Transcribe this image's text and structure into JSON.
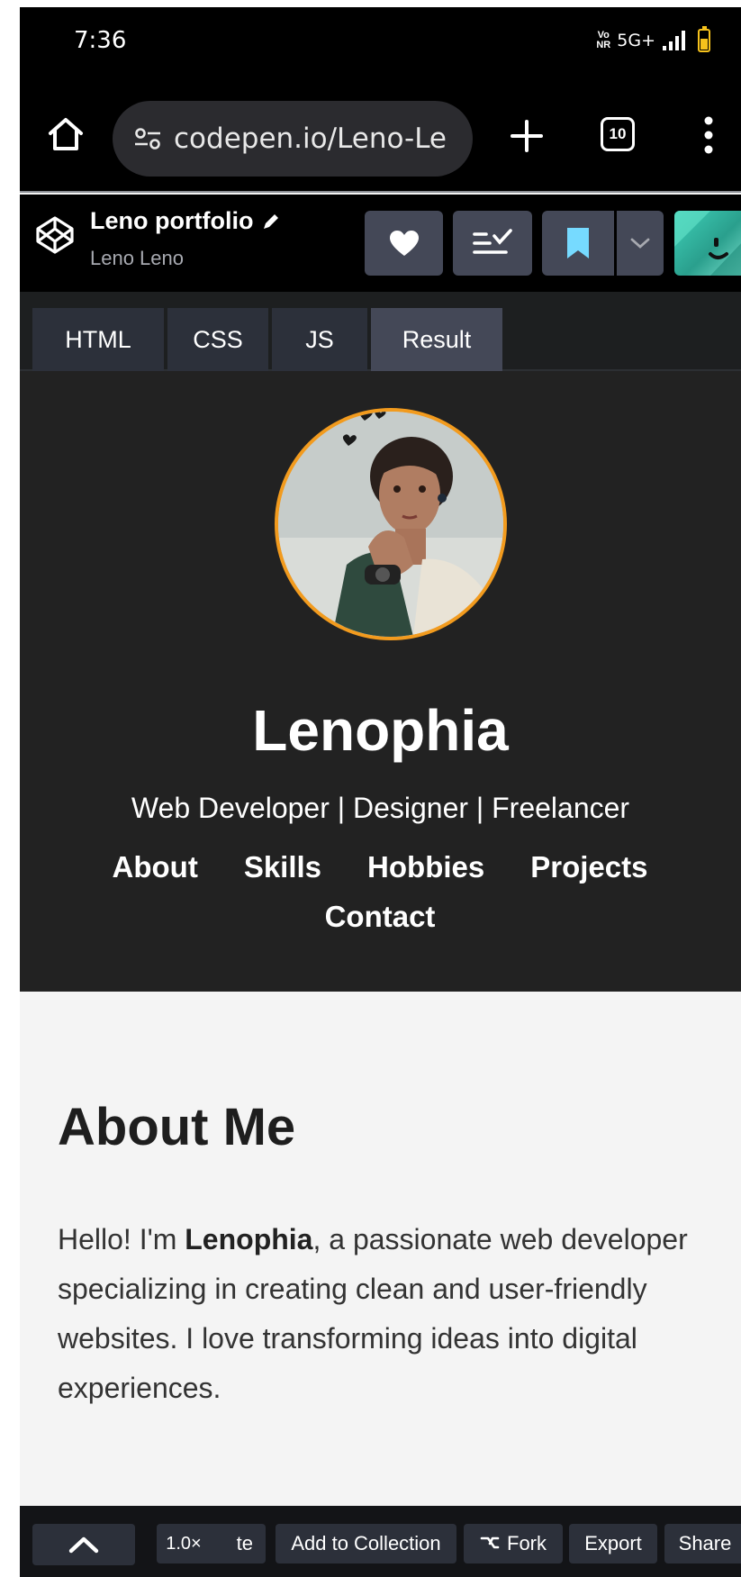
{
  "status_bar": {
    "time": "7:36",
    "volte_top": "Vo",
    "volte_bottom": "NR",
    "network": "5G+",
    "battery_level": 0.55,
    "battery_color": "#f6c21c"
  },
  "browser": {
    "url": "codepen.io/Leno-Le",
    "tab_count": "10",
    "icons": [
      "home-icon",
      "site-settings-icon",
      "plus-icon",
      "tabs-icon",
      "more-vert-icon"
    ]
  },
  "pen_header": {
    "title": "Leno portfolio",
    "author": "Leno Leno",
    "icons": [
      "codepen-logo-icon",
      "pencil-icon",
      "heart-icon",
      "views-list-icon",
      "bookmark-icon",
      "chevron-down-icon",
      "user-avatar"
    ]
  },
  "editor_tabs": [
    {
      "label": "HTML"
    },
    {
      "label": "CSS"
    },
    {
      "label": "JS"
    },
    {
      "label": "Result",
      "active": true
    }
  ],
  "result": {
    "hero": {
      "name": "Lenophia",
      "subtitle": "Web Developer | Designer | Freelancer",
      "nav": [
        "About",
        "Skills",
        "Hobbies",
        "Projects",
        "Contact"
      ],
      "accent": "#f29b1e",
      "background": "#222222"
    },
    "about": {
      "title": "About Me",
      "text_before": "Hello! I'm ",
      "name_bold": "Lenophia",
      "text_after": ", a passionate web developer specializing in creating clean and user-friendly websites. I love transforming ideas into digital experiences."
    }
  },
  "bottom_bar": {
    "zoom": "1.0×",
    "delete_partial": "te",
    "add_to_collection": "Add to Collection",
    "fork": "Fork",
    "export": "Export",
    "share": "Share"
  },
  "colors": {
    "cp_button": "#444857",
    "cp_tab": "#2c303a",
    "bookmark": "#76daff"
  }
}
